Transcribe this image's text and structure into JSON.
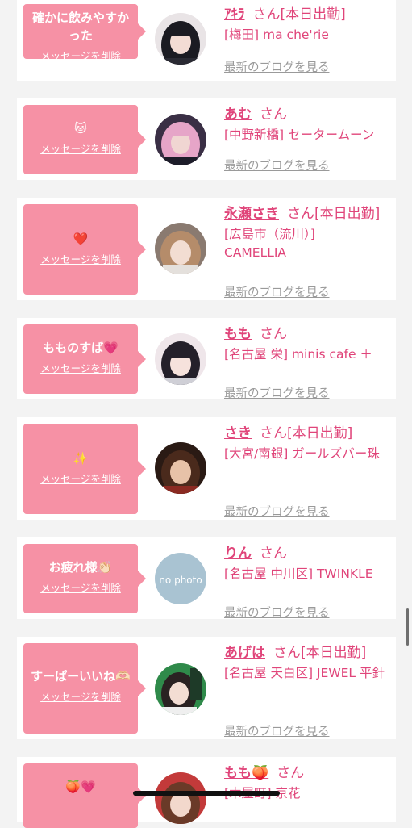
{
  "delete_label": "メッセージを削除",
  "blog_label": "最新のブログを見る",
  "san": "さん",
  "colors": {
    "accent": "#e0457a",
    "bubble": "#f691a5",
    "link_gray": "#9a9a9a"
  },
  "cards": [
    {
      "message": "確かに飲みやすかった",
      "name": "ｱｷﾗ",
      "badge": "[本日出勤]",
      "shop": "[梅田] ma che'rie",
      "avatar": "girl-black-hair"
    },
    {
      "message": "🐱",
      "name": "あむ",
      "badge": "",
      "shop": "[中野新橋] セータームーン",
      "avatar": "girl-pink-hair"
    },
    {
      "message": "❤️",
      "name": "永瀬さき",
      "badge": "[本日出勤]",
      "shop": "[広島市（流川）] CAMELLIA",
      "avatar": "girl-light-brown"
    },
    {
      "message": "もものすば💗",
      "name": "もも",
      "badge": "",
      "shop": "[名古屋 栄] minis cafe ＋",
      "avatar": "girl-dark-bangs"
    },
    {
      "message": "✨",
      "name": "さき",
      "badge": "[本日出勤]",
      "shop": "[大宮/南銀] ガールズバー珠",
      "avatar": "girl-dark-room"
    },
    {
      "message": "お疲れ様👏🏻",
      "name": "りん",
      "badge": "",
      "shop": "[名古屋 中川区] TWINKLE",
      "avatar": "no-photo",
      "avatar_text": "no photo"
    },
    {
      "message": "すーぱーいいね🫶🏻",
      "name": "あげは",
      "badge": "[本日出勤]",
      "shop": "[名古屋 天白区] JEWEL 平針",
      "avatar": "girl-green-bg"
    },
    {
      "message": "🍑💗",
      "name": "もも🍑",
      "badge": "",
      "shop": "[木屋町] 京花",
      "avatar": "girl-partial"
    }
  ]
}
